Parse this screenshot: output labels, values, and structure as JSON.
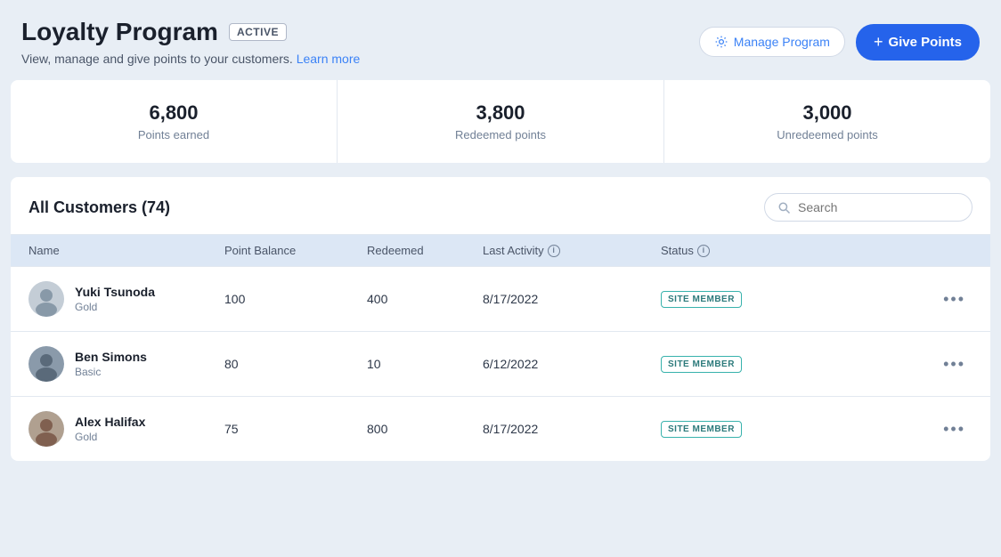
{
  "header": {
    "title": "Loyalty Program",
    "badge": "ACTIVE",
    "subtitle": "View, manage and give points to your customers.",
    "learn_more": "Learn more",
    "manage_btn": "Manage Program",
    "give_points_btn": "Give Points"
  },
  "stats": [
    {
      "value": "6,800",
      "label": "Points earned"
    },
    {
      "value": "3,800",
      "label": "Redeemed points"
    },
    {
      "value": "3,000",
      "label": "Unredeemed points"
    }
  ],
  "customers": {
    "title": "All Customers (74)",
    "search_placeholder": "Search",
    "columns": [
      {
        "label": "Name",
        "info": false
      },
      {
        "label": "Point Balance",
        "info": false
      },
      {
        "label": "Redeemed",
        "info": false
      },
      {
        "label": "Last Activity",
        "info": true
      },
      {
        "label": "Status",
        "info": true
      }
    ],
    "rows": [
      {
        "name": "Yuki Tsunoda",
        "tier": "Gold",
        "point_balance": "100",
        "redeemed": "400",
        "last_activity": "8/17/2022",
        "status": "SITE MEMBER",
        "avatar_color": "#b0b8c0"
      },
      {
        "name": "Ben Simons",
        "tier": "Basic",
        "point_balance": "80",
        "redeemed": "10",
        "last_activity": "6/12/2022",
        "status": "SITE MEMBER",
        "avatar_color": "#8899aa"
      },
      {
        "name": "Alex Halifax",
        "tier": "Gold",
        "point_balance": "75",
        "redeemed": "800",
        "last_activity": "8/17/2022",
        "status": "SITE MEMBER",
        "avatar_color": "#a09080"
      }
    ]
  },
  "icons": {
    "search": "⌕",
    "plus": "+",
    "more": "..."
  }
}
